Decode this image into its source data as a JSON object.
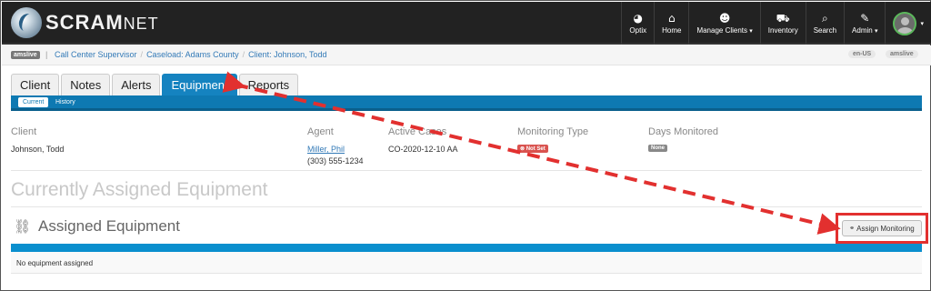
{
  "brand": {
    "name": "SCRAM",
    "suffix": "NET"
  },
  "nav": [
    {
      "label": "Optix",
      "icon": "dashboard-icon",
      "glyph": "◕"
    },
    {
      "label": "Home",
      "icon": "home-icon",
      "glyph": "⌂"
    },
    {
      "label": "Manage Clients",
      "icon": "user-icon",
      "glyph": "☻",
      "caret": "▾"
    },
    {
      "label": "Inventory",
      "icon": "truck-icon",
      "glyph": "⛟"
    },
    {
      "label": "Search",
      "icon": "search-icon",
      "glyph": "⌕"
    },
    {
      "label": "Admin",
      "icon": "wrench-icon",
      "glyph": "✎",
      "caret": "▾"
    }
  ],
  "breadcrumb": {
    "env_badge": "amslive",
    "divider": "|",
    "items": [
      "Call Center Supervisor",
      "Caseload: Adams County",
      "Client: Johnson, Todd"
    ],
    "locale": "en-US",
    "server": "amslive"
  },
  "tabs": [
    "Client",
    "Notes",
    "Alerts",
    "Equipment",
    "Reports"
  ],
  "active_tab": "Equipment",
  "subtabs": [
    "Current",
    "History"
  ],
  "info": {
    "client_label": "Client",
    "client_name": "Johnson, Todd",
    "agent_label": "Agent",
    "agent_name": "Miller, Phil",
    "agent_phone": "(303) 555-1234",
    "cases_label": "Active Cases",
    "case_number": "CO-2020-12-10 AA",
    "monitoring_label": "Monitoring Type",
    "monitoring_value": "Not Set",
    "days_label": "Days Monitored",
    "days_value": "None"
  },
  "currently_assigned_title": "Currently Assigned Equipment",
  "assigned_title": "Assigned Equipment",
  "assign_button": "Assign Monitoring",
  "empty_message": "No equipment assigned",
  "colors": {
    "navbar": "#222222",
    "primary": "#0e79b2",
    "annotation": "#e2302f"
  }
}
